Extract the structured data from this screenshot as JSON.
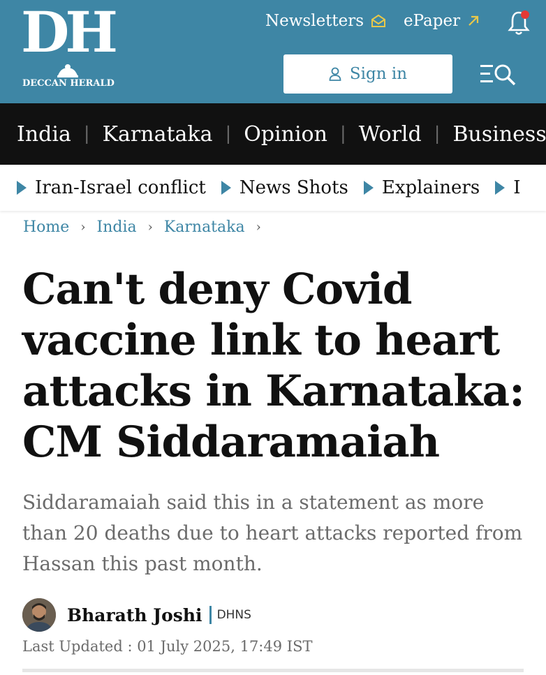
{
  "header": {
    "logo_letters": "DH",
    "logo_name": "DECCAN HERALD",
    "newsletters_label": "Newsletters",
    "epaper_label": "ePaper",
    "signin_label": "Sign in",
    "brand_color": "#3e86a5",
    "accent_color": "#e8c84a",
    "alert_color": "#e53935"
  },
  "main_nav": {
    "items": [
      "India",
      "Karnataka",
      "Opinion",
      "World",
      "Business"
    ]
  },
  "topics": {
    "items": [
      "Iran-Israel conflict",
      "News Shots",
      "Explainers",
      "I"
    ]
  },
  "breadcrumb": {
    "items": [
      "Home",
      "India",
      "Karnataka"
    ]
  },
  "article": {
    "headline": "Can't deny Covid vaccine link to heart attacks in Karnataka: CM Siddaramaiah",
    "summary": "Siddaramaiah said this in a statement as more than 20 deaths due to heart attacks reported from Hassan this past month.",
    "author": "Bharath Joshi",
    "author_org": "DHNS",
    "last_updated": "Last Updated : 01 July 2025, 17:49 IST"
  },
  "icons": {
    "newsletters": "envelope-icon",
    "epaper": "arrow-up-right-icon",
    "notifications": "bell-icon",
    "signin": "person-icon",
    "menu": "menu-search-icon",
    "topic_marker": "play-triangle-icon",
    "breadcrumb_sep": "chevron-right-icon"
  }
}
